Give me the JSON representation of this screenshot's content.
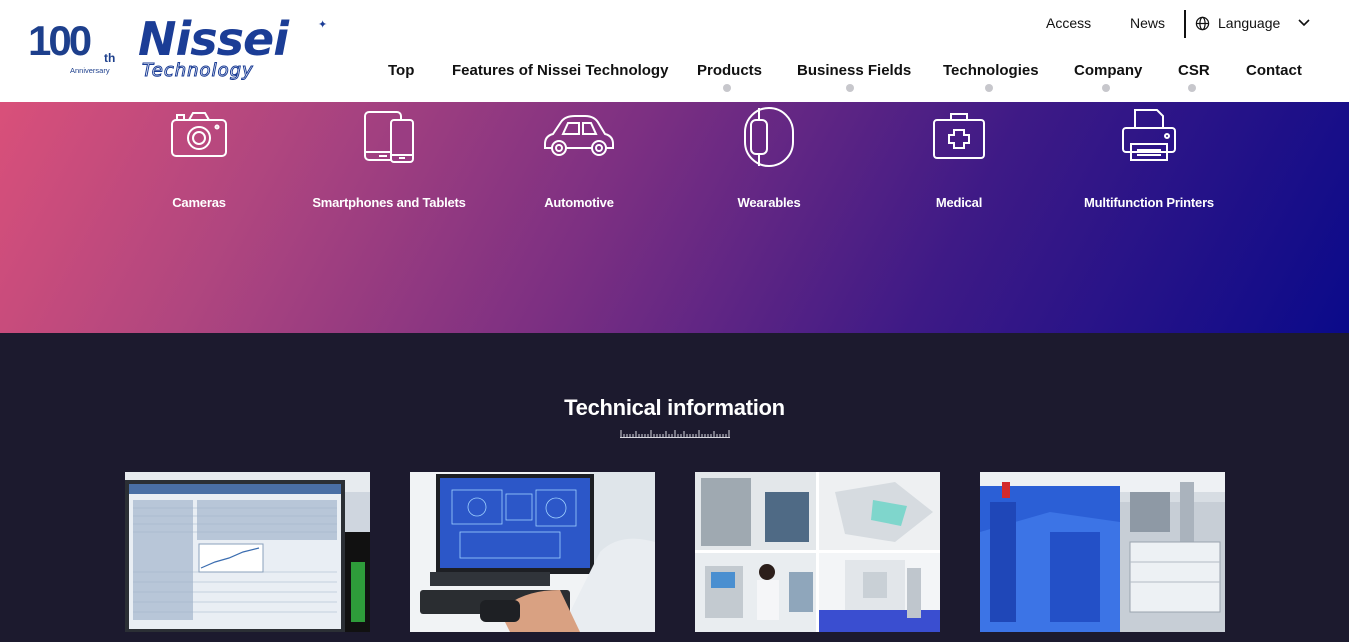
{
  "header": {
    "logo_anniversary": {
      "number": "100",
      "suffix": "th",
      "caption": "Anniversary"
    },
    "logo_brand": {
      "word": "Nissei",
      "sub": "Technology"
    },
    "utility": {
      "access": "Access",
      "news": "News",
      "language": "Language"
    },
    "nav": [
      {
        "label": "Top",
        "has_submenu": false
      },
      {
        "label": "Features of Nissei Technology",
        "has_submenu": false
      },
      {
        "label": "Products",
        "has_submenu": true
      },
      {
        "label": "Business Fields",
        "has_submenu": true
      },
      {
        "label": "Technologies",
        "has_submenu": true
      },
      {
        "label": "Company",
        "has_submenu": true
      },
      {
        "label": "CSR",
        "has_submenu": true
      },
      {
        "label": "Contact",
        "has_submenu": false
      }
    ]
  },
  "business_fields": [
    {
      "label": "Cameras",
      "icon": "camera-icon"
    },
    {
      "label": "Smartphones and Tablets",
      "icon": "smartphone-tablet-icon"
    },
    {
      "label": "Automotive",
      "icon": "car-icon"
    },
    {
      "label": "Wearables",
      "icon": "smartwatch-icon"
    },
    {
      "label": "Medical",
      "icon": "medical-kit-icon"
    },
    {
      "label": "Multifunction Printers",
      "icon": "printer-icon"
    }
  ],
  "technical": {
    "title": "Technical information",
    "cards": [
      {
        "image": "monitor-spreadsheet-photo"
      },
      {
        "image": "cad-workstation-photo"
      },
      {
        "image": "equipment-collage-photo"
      },
      {
        "image": "injection-molding-machine-photo"
      }
    ]
  },
  "colors": {
    "brand": "#1b3d96",
    "gradient_start": "#d9507a",
    "gradient_end": "#0a0a8a",
    "dark_bg": "#1c1a2e"
  }
}
